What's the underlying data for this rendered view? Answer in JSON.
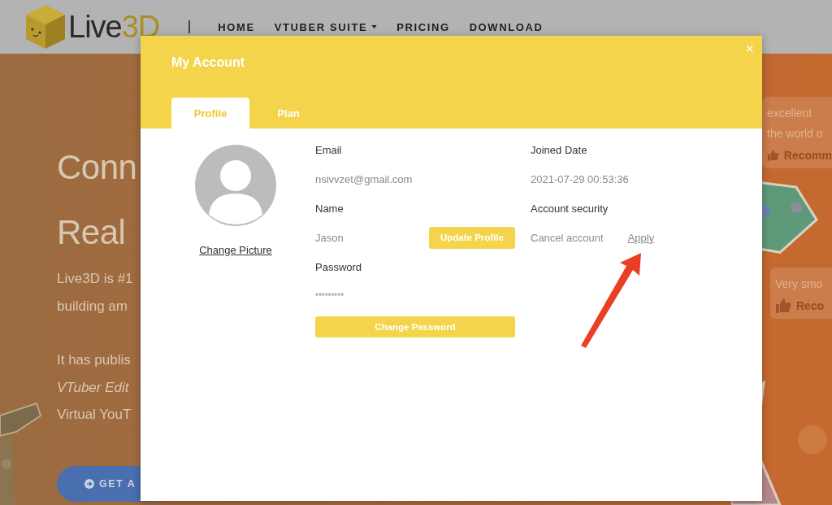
{
  "site": {
    "logo": {
      "text": "Live",
      "accent": "3D"
    },
    "nav": [
      {
        "label": "HOME",
        "kind": "link"
      },
      {
        "label": "VTUBER SUITE",
        "kind": "dropdown"
      },
      {
        "label": "PRICING",
        "kind": "link"
      },
      {
        "label": "DOWNLOAD",
        "kind": "link"
      }
    ]
  },
  "hero": {
    "heading": [
      "Conn",
      "Real"
    ],
    "paragraphs": [
      [
        {
          "text": "Live3D is #1",
          "italic": false
        },
        {
          "text": "building am",
          "italic": false
        }
      ],
      [
        {
          "text": "It has publis",
          "italic": false
        },
        {
          "text": "VTuber Edit",
          "italic": true
        },
        {
          "text": "Virtual YouT",
          "italic": false
        }
      ]
    ],
    "button": "GET A"
  },
  "side_cards": [
    {
      "lines": [
        "excellent",
        "the world o"
      ],
      "action": "Recomm"
    },
    {
      "lines": [
        "Very smo"
      ],
      "action": "Reco"
    }
  ],
  "modal": {
    "title": "My Account",
    "close": "×",
    "tabs": [
      {
        "label": "Profile",
        "selected": true
      },
      {
        "label": "Plan",
        "selected": false
      }
    ],
    "change_picture": "Change Picture",
    "left_fields": [
      {
        "label": "Email",
        "value": "nsivvzet@gmail.com"
      },
      {
        "label": "Name",
        "value": "Jason",
        "button": "Update Profile"
      },
      {
        "label": "Password",
        "value": "*********"
      }
    ],
    "change_password": "Change Password",
    "right_fields": [
      {
        "label": "Joined Date",
        "value": "2021-07-29 00:53:36"
      },
      {
        "label": "Account security",
        "value": "Cancel account",
        "link": "Apply"
      }
    ]
  }
}
